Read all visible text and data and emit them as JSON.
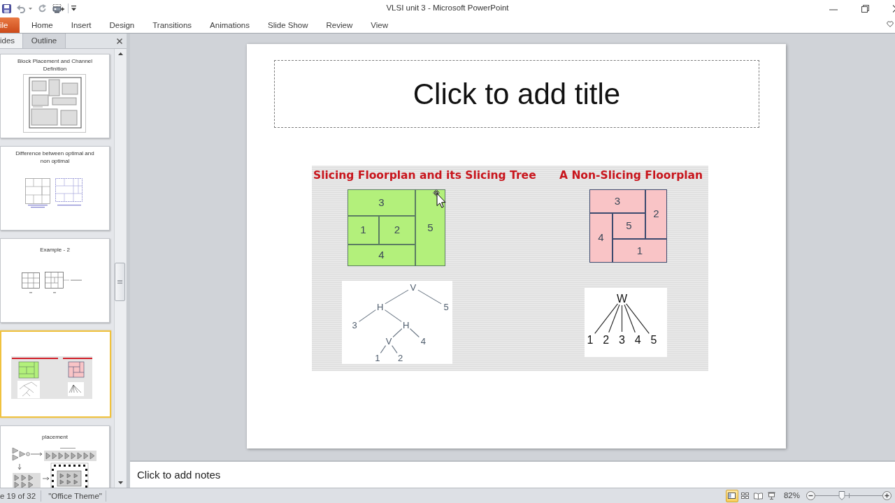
{
  "window": {
    "title": "VLSI unit 3 - Microsoft PowerPoint"
  },
  "ribbon_tabs": [
    {
      "label": "ile",
      "kind": "file"
    },
    {
      "label": "Home",
      "kind": "tab"
    },
    {
      "label": "Insert",
      "kind": "tab"
    },
    {
      "label": "Design",
      "kind": "tab"
    },
    {
      "label": "Transitions",
      "kind": "tab"
    },
    {
      "label": "Animations",
      "kind": "tab"
    },
    {
      "label": "Slide Show",
      "kind": "tab"
    },
    {
      "label": "Review",
      "kind": "tab"
    },
    {
      "label": "View",
      "kind": "tab"
    }
  ],
  "panel_tabs": [
    {
      "label": "ides",
      "selected": true
    },
    {
      "label": "Outline",
      "selected": false
    }
  ],
  "thumbnails": [
    {
      "title": "Block Placement and Channel Definition",
      "kind": "blocks",
      "selected": false
    },
    {
      "title": "Difference between optimal and non optimal",
      "kind": "compare",
      "selected": false
    },
    {
      "title": "Example - 2",
      "kind": "example",
      "selected": false
    },
    {
      "kind": "floorplans",
      "selected": true
    },
    {
      "title": "placement",
      "kind": "circuit",
      "selected": false
    }
  ],
  "slide": {
    "title": {
      "placeholder": "Click to add title"
    },
    "figure": {
      "left": {
        "heading": "Slicing Floorplan and its Slicing Tree",
        "blocks": [
          "3",
          "1",
          "2",
          "5",
          "4"
        ],
        "tree": {
          "label": "V",
          "children": [
            {
              "label": "H",
              "children": [
                {
                  "label": "3"
                },
                {
                  "label": "H",
                  "children": [
                    {
                      "label": "V",
                      "children": [
                        {
                          "label": "1"
                        },
                        {
                          "label": "2"
                        }
                      ]
                    },
                    {
                      "label": "4"
                    }
                  ]
                }
              ]
            },
            {
              "label": "5"
            }
          ]
        }
      },
      "right": {
        "heading": "A Non-Slicing Floorplan",
        "blocks": [
          "3",
          "2",
          "5",
          "4",
          "1"
        ],
        "tree": {
          "label": "W",
          "children": [
            {
              "label": "1"
            },
            {
              "label": "2"
            },
            {
              "label": "3"
            },
            {
              "label": "4"
            },
            {
              "label": "5"
            }
          ]
        }
      }
    }
  },
  "notes": {
    "placeholder": "Click to add notes"
  },
  "status_bar": {
    "slide_position": "e 19 of 32",
    "theme": "\"Office Theme\"",
    "views": [
      {
        "kind": "normal",
        "selected": true
      },
      {
        "kind": "sorter",
        "selected": false
      },
      {
        "kind": "reading",
        "selected": false
      },
      {
        "kind": "slideshow",
        "selected": false
      }
    ],
    "zoom": {
      "reading": "82%",
      "level": 0.4
    }
  }
}
